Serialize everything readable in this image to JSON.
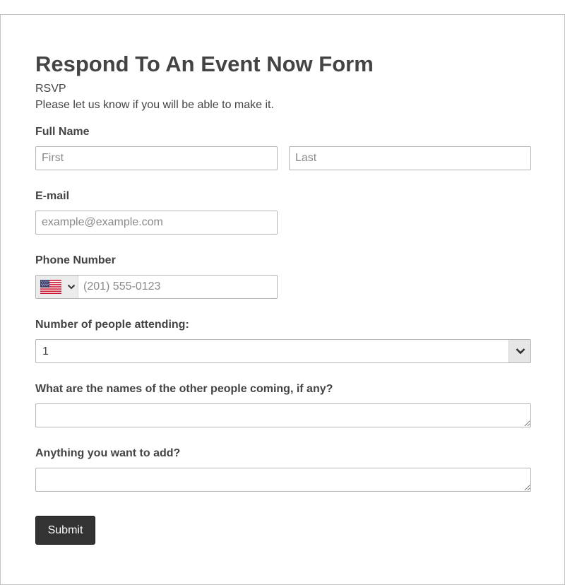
{
  "form": {
    "title": "Respond To An Event Now Form",
    "subtitle": "RSVP",
    "description": "Please let us know if you will be able to make it."
  },
  "full_name": {
    "label": "Full Name",
    "first_placeholder": "First",
    "last_placeholder": "Last"
  },
  "email": {
    "label": "E-mail",
    "placeholder": "example@example.com"
  },
  "phone": {
    "label": "Phone Number",
    "country_icon": "us-flag-icon",
    "placeholder": "(201) 555-0123"
  },
  "attendees": {
    "label": "Number of people attending:",
    "selected": "1"
  },
  "other_people": {
    "label": "What are the names of the other people coming, if any?"
  },
  "additional": {
    "label": "Anything you want to add?"
  },
  "submit_label": "Submit",
  "colors": {
    "text": "#444444",
    "border": "#b5b5b5",
    "button": "#333333",
    "button_text": "#ffffff"
  }
}
